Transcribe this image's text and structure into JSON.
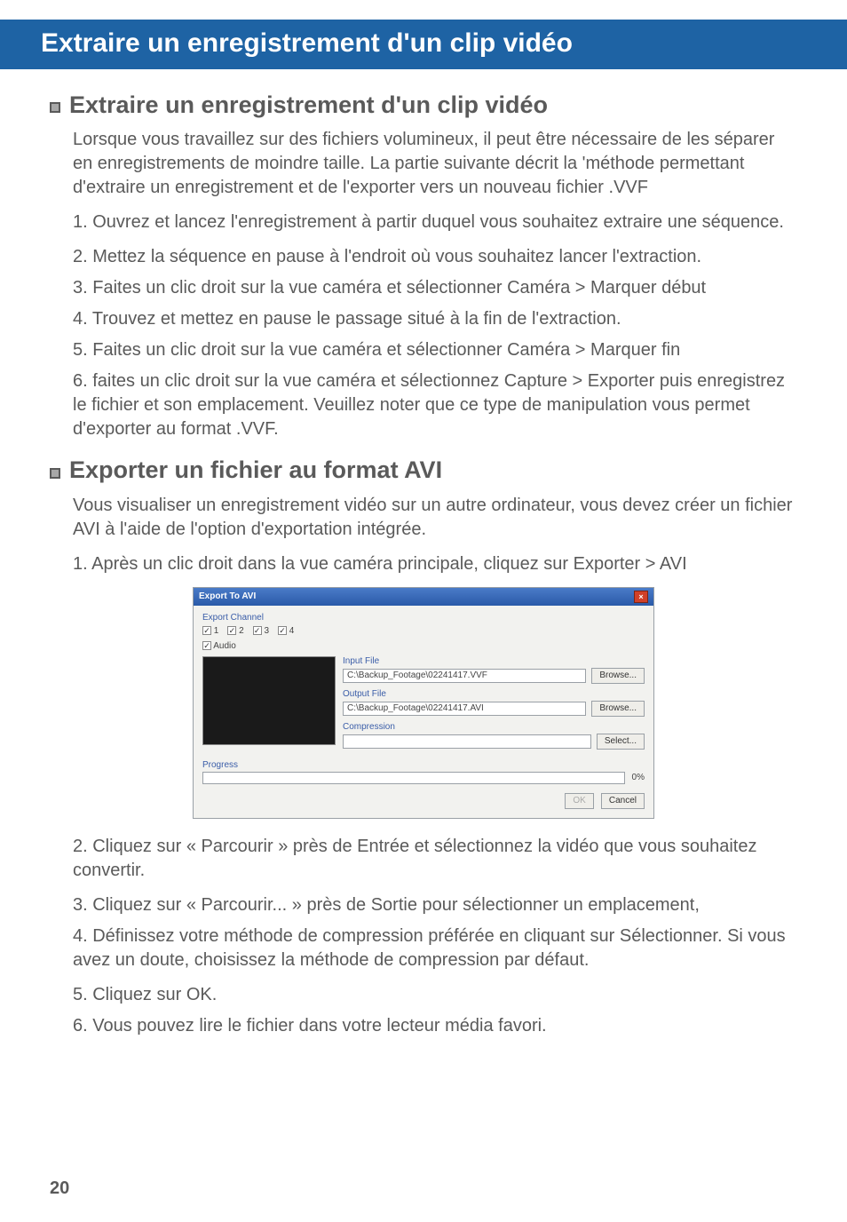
{
  "banner": "Extraire un enregistrement d'un clip vidéo",
  "section1": {
    "title": "Extraire un enregistrement d'un clip vidéo",
    "intro": "Lorsque vous travaillez sur des fichiers volumineux, il peut être nécessaire de les séparer en enregistrements de moindre taille.  La partie suivante décrit la 'méthode permettant d'extraire un enregistrement et de l'exporter vers un nouveau fichier .VVF",
    "steps": {
      "s1": "1.  Ouvrez et lancez l'enregistrement à partir duquel vous souhaitez extraire une séquence.",
      "s2": "2.  Mettez la séquence en pause à l'endroit où vous souhaitez lancer l'extraction.",
      "s3": "3.  Faites un clic droit sur la vue caméra et sélectionner Caméra > Marquer début",
      "s4": "4.  Trouvez et mettez en pause le passage situé à la fin de l'extraction.",
      "s5": "5.  Faites un clic droit sur la vue caméra et sélectionner Caméra > Marquer fin",
      "s6": "6.  faites un clic droit sur la vue caméra et sélectionnez Capture > Exporter puis enregistrez le fichier et son emplacement.  Veuillez noter que ce type de manipulation vous permet d'exporter au format .VVF."
    }
  },
  "section2": {
    "title": "Exporter un fichier au format AVI",
    "intro": "Vous visualiser un enregistrement vidéo sur un autre ordinateur, vous devez créer un fichier AVI à l'aide de l'option d'exportation intégrée.",
    "step1": "1.  Après un clic droit dans la vue caméra principale, cliquez sur Exporter > AVI",
    "step2": "2.  Cliquez sur « Parcourir » près de Entrée et sélectionnez la vidéo que vous souhaitez convertir.",
    "step3": "3.  Cliquez sur « Parcourir... » près de Sortie pour sélectionner un emplacement,",
    "step4": "4.  Définissez votre méthode de compression préférée en cliquant sur Sélectionner.  Si vous avez un doute, choisissez la méthode de compression par défaut.",
    "step5": "5.  Cliquez sur OK.",
    "step6": "6.  Vous pouvez lire le fichier dans votre lecteur média favori."
  },
  "dialog": {
    "title": "Export To AVI",
    "export_channel": "Export Channel",
    "audio": "Audio",
    "input_file_label": "Input File",
    "input_file_value": "C:\\Backup_Footage\\02241417.VVF",
    "output_file_label": "Output File",
    "output_file_value": "C:\\Backup_Footage\\02241417.AVI",
    "compression_label": "Compression",
    "compression_value": "",
    "browse": "Browse...",
    "select": "Select...",
    "progress_label": "Progress",
    "progress_value": "0%",
    "ok": "OK",
    "cancel": "Cancel"
  },
  "page_number": "20"
}
